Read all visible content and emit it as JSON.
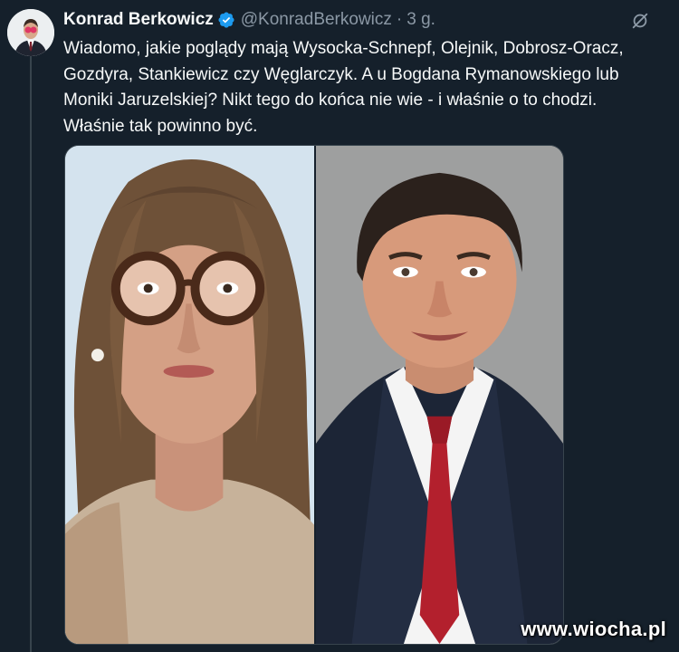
{
  "tweet": {
    "author_name": "Konrad Berkowicz",
    "handle": "@KonradBerkowicz",
    "separator": "·",
    "time": "3 g.",
    "text_lines": [
      "Wiadomo, jakie poglądy mają Wysocka-Schnepf, Olejnik, Dobrosz-Oracz,",
      "Gozdyra,  Stankiewicz czy Węglarczyk. A u Bogdana Rymanowskiego lub",
      "Moniki Jaruzelskiej? Nikt tego do końca nie wie - i właśnie o to chodzi.",
      "Właśnie tak powinno być."
    ]
  },
  "icons": {
    "verified": "verified-badge-icon",
    "more": "grok-slash-icon"
  },
  "colors": {
    "background": "#15202b",
    "text": "#f7f9f9",
    "secondary_text": "#8b98a5",
    "verified_blue": "#1d9bf0"
  },
  "watermark": "www.wiocha.pl"
}
